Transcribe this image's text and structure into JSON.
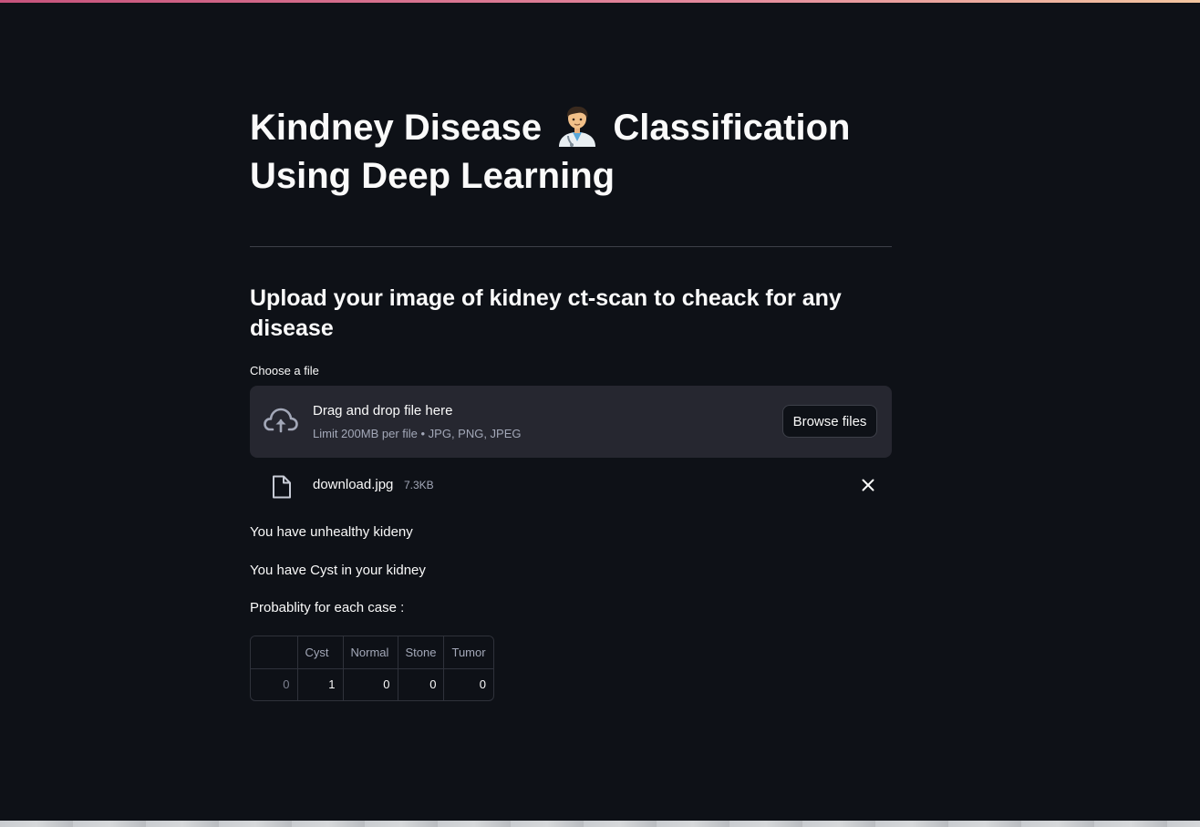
{
  "title": {
    "part1": "Kindney Disease",
    "emoji_name": "health-worker-emoji",
    "part2": "Classification Using Deep Learning"
  },
  "subheader": "Upload your image of kidney ct-scan to cheack for any disease",
  "uploader": {
    "label": "Choose a file",
    "drop_title": "Drag and drop file here",
    "limit": "Limit 200MB per file • JPG, PNG, JPEG",
    "browse_label": "Browse files",
    "icon": "cloud-upload-icon"
  },
  "uploaded_file": {
    "name": "download.jpg",
    "size": "7.3KB",
    "icon": "file-icon",
    "remove_icon": "close-icon"
  },
  "results": {
    "status": "You have unhealthy kideny",
    "diagnosis": "You have Cyst in your kidney",
    "probability_label": "Probablity for each case :"
  },
  "table": {
    "columns": [
      "",
      "Cyst",
      "Normal",
      "Stone",
      "Tumor"
    ],
    "rows": [
      [
        "0",
        "1",
        "0",
        "0",
        "0"
      ]
    ]
  },
  "colors": {
    "background": "#0e1117",
    "dropzone": "#262730",
    "text": "#fafafa",
    "muted": "#a3a8b8"
  }
}
